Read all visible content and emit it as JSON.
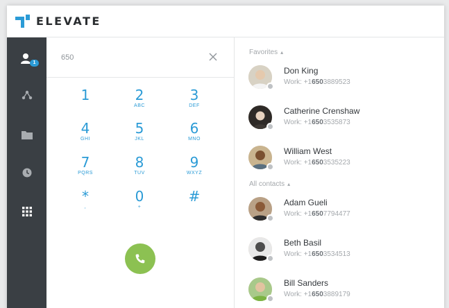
{
  "app": {
    "brand": "ELEVATE",
    "brand_color": "#2b9bd6"
  },
  "rail": {
    "items": [
      {
        "icon": "contacts-icon",
        "badge": "1",
        "active": true
      },
      {
        "icon": "network-icon"
      },
      {
        "icon": "folder-icon"
      },
      {
        "icon": "clock-icon"
      },
      {
        "icon": "dialpad-icon"
      }
    ]
  },
  "dialer": {
    "number": "650",
    "keys": [
      {
        "digit": "1",
        "letters": ""
      },
      {
        "digit": "2",
        "letters": "ABC"
      },
      {
        "digit": "3",
        "letters": "DEF"
      },
      {
        "digit": "4",
        "letters": "GHI"
      },
      {
        "digit": "5",
        "letters": "JKL"
      },
      {
        "digit": "6",
        "letters": "MNO"
      },
      {
        "digit": "7",
        "letters": "PQRS"
      },
      {
        "digit": "8",
        "letters": "TUV"
      },
      {
        "digit": "9",
        "letters": "WXYZ"
      },
      {
        "digit": "*",
        "letters": ","
      },
      {
        "digit": "0",
        "letters": "+"
      },
      {
        "digit": "#",
        "letters": ""
      }
    ],
    "call_color": "#8cc152"
  },
  "contacts": {
    "favorites_label": "Favorites",
    "all_label": "All contacts",
    "favorites": [
      {
        "name": "Don King",
        "phone_label": "Work: +1",
        "phone_match": "650",
        "phone_rest": "3889523"
      },
      {
        "name": "Catherine Crenshaw",
        "phone_label": "Work: +1",
        "phone_match": "650",
        "phone_rest": "3535873"
      },
      {
        "name": "William West",
        "phone_label": "Work: +1",
        "phone_match": "650",
        "phone_rest": "3535223"
      }
    ],
    "all": [
      {
        "name": "Adam Gueli",
        "phone_label": "Work: +1",
        "phone_match": "650",
        "phone_rest": "7794477"
      },
      {
        "name": "Beth Basil",
        "phone_label": "Work: +1",
        "phone_match": "650",
        "phone_rest": "3534513"
      },
      {
        "name": "Bill Sanders",
        "phone_label": "Work: +1",
        "phone_match": "650",
        "phone_rest": "3889179"
      }
    ]
  }
}
